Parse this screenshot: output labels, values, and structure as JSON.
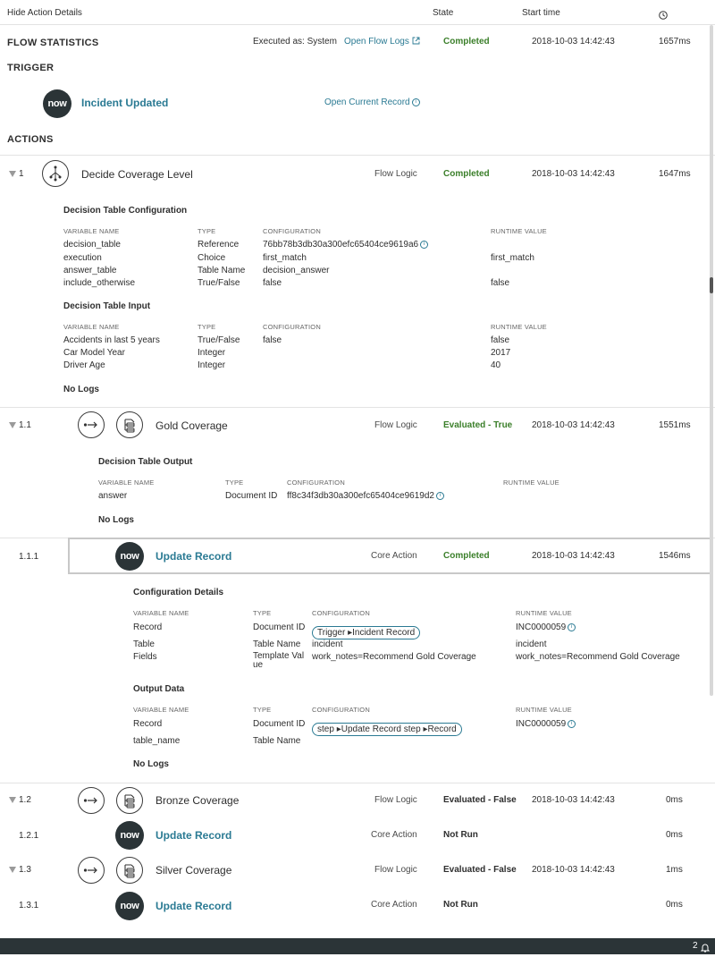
{
  "header": {
    "hide_details": "Hide Action Details",
    "state": "State",
    "start_time": "Start time"
  },
  "flow_stats": {
    "title": "FLOW STATISTICS",
    "executed_as": "Executed as: System",
    "open_logs": "Open Flow Logs",
    "state": "Completed",
    "start": "2018-10-03 14:42:43",
    "duration": "1657ms"
  },
  "trigger": {
    "title": "TRIGGER",
    "name": "Incident Updated",
    "open_record": "Open Current Record",
    "logo": "now"
  },
  "actions_title": "ACTIONS",
  "action1": {
    "num": "1",
    "name": "Decide Coverage Level",
    "type": "Flow Logic",
    "state": "Completed",
    "start": "2018-10-03 14:42:43",
    "duration": "1647ms",
    "dtc_title": "Decision Table Configuration",
    "cols": {
      "var": "VARIABLE NAME",
      "type": "TYPE",
      "config": "CONFIGURATION",
      "runtime": "RUNTIME VALUE"
    },
    "dtc_rows": [
      {
        "var": "decision_table",
        "type": "Reference",
        "config": "76bb78b3db30a300efc65404ce9619a6",
        "runtime": ""
      },
      {
        "var": "execution",
        "type": "Choice",
        "config": "first_match",
        "runtime": "first_match"
      },
      {
        "var": "answer_table",
        "type": "Table Name",
        "config": "decision_answer",
        "runtime": ""
      },
      {
        "var": "include_otherwise",
        "type": "True/False",
        "config": "false",
        "runtime": "false"
      }
    ],
    "dti_title": "Decision Table Input",
    "dti_rows": [
      {
        "var": "Accidents in last 5 years",
        "type": "True/False",
        "config": "false",
        "runtime": "false"
      },
      {
        "var": "Car Model Year",
        "type": "Integer",
        "config": "",
        "runtime": "2017"
      },
      {
        "var": "Driver Age",
        "type": "Integer",
        "config": "",
        "runtime": "40"
      }
    ],
    "no_logs": "No Logs"
  },
  "action11": {
    "num": "1.1",
    "name": "Gold Coverage",
    "type": "Flow Logic",
    "state": "Evaluated - True",
    "start": "2018-10-03 14:42:43",
    "duration": "1551ms",
    "out_title": "Decision Table Output",
    "row": {
      "var": "answer",
      "type": "Document ID",
      "config": "ff8c34f3db30a300efc65404ce9619d2"
    },
    "no_logs": "No Logs"
  },
  "action111": {
    "num": "1.1.1",
    "name": "Update Record",
    "type": "Core Action",
    "state": "Completed",
    "start": "2018-10-03 14:42:43",
    "duration": "1546ms",
    "cfg_title": "Configuration Details",
    "cfg_rows": [
      {
        "var": "Record",
        "type": "Document ID",
        "config_pill_a": "Trigger",
        "config_pill_b": "Incident Record",
        "runtime": "INC0000059"
      },
      {
        "var": "Table",
        "type": "Table Name",
        "config": "incident",
        "runtime": "incident"
      },
      {
        "var": "Fields",
        "type_a": "Template Val",
        "type_b": "ue",
        "config": "work_notes=Recommend Gold Coverage",
        "runtime": "work_notes=Recommend Gold Coverage"
      }
    ],
    "out_title": "Output Data",
    "out_rows": [
      {
        "var": "Record",
        "type": "Document ID",
        "pill_a": "step",
        "pill_b": "Update Record step",
        "pill_c": "Record",
        "runtime": "INC0000059"
      },
      {
        "var": "table_name",
        "type": "Table Name"
      }
    ],
    "no_logs": "No Logs"
  },
  "action12": {
    "num": "1.2",
    "name": "Bronze Coverage",
    "type": "Flow Logic",
    "state": "Evaluated - False",
    "start": "2018-10-03 14:42:43",
    "duration": "0ms"
  },
  "action121": {
    "num": "1.2.1",
    "name": "Update Record",
    "type": "Core Action",
    "state": "Not Run",
    "duration": "0ms"
  },
  "action13": {
    "num": "1.3",
    "name": "Silver Coverage",
    "type": "Flow Logic",
    "state": "Evaluated - False",
    "start": "2018-10-03 14:42:43",
    "duration": "1ms"
  },
  "action131": {
    "num": "1.3.1",
    "name": "Update Record",
    "type": "Core Action",
    "state": "Not Run",
    "duration": "0ms"
  },
  "footer": {
    "badge": "2"
  }
}
